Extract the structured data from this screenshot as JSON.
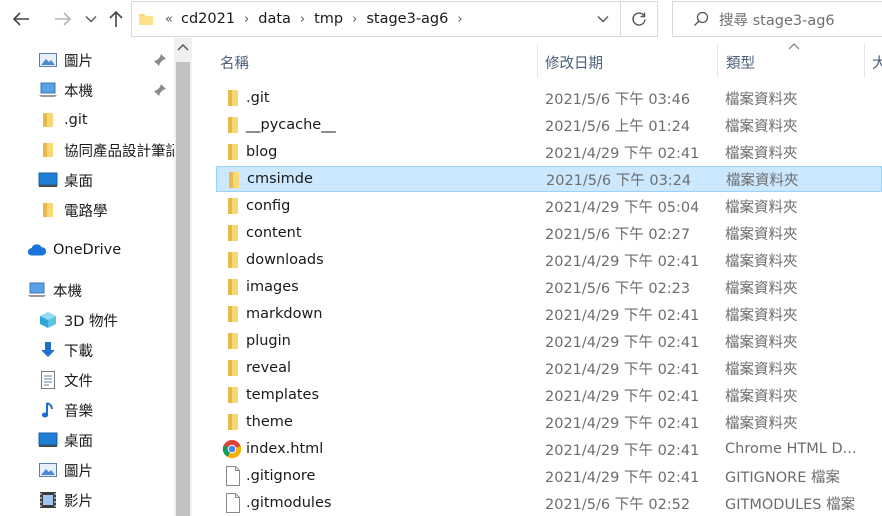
{
  "toolbar": {
    "back_icon": "back-arrow-icon",
    "forward_icon": "forward-arrow-icon",
    "recent_icon": "chevron-down-icon",
    "up_icon": "up-arrow-icon",
    "refresh_icon": "refresh-icon"
  },
  "address": {
    "overflow": "«",
    "crumbs": [
      "cd2021",
      "data",
      "tmp",
      "stage3-ag6"
    ],
    "separator": "›"
  },
  "search": {
    "placeholder": "搜尋 stage3-ag6"
  },
  "nav": {
    "items": [
      {
        "label": "圖片",
        "icon": "pictures-icon",
        "pinned": true
      },
      {
        "label": "本機",
        "icon": "this-pc-icon",
        "pinned": true
      },
      {
        "label": ".git",
        "icon": "folder-icon",
        "pinned": false
      },
      {
        "label": "協同產品設計筆記",
        "icon": "folder-icon",
        "pinned": false
      },
      {
        "label": "桌面",
        "icon": "desktop-icon",
        "pinned": false
      },
      {
        "label": "電路學",
        "icon": "folder-icon",
        "pinned": false
      },
      {
        "label": "OneDrive",
        "icon": "onedrive-icon",
        "pinned": false
      },
      {
        "label": "本機",
        "icon": "this-pc-icon",
        "pinned": false
      },
      {
        "label": "3D 物件",
        "icon": "3d-objects-icon",
        "pinned": false
      },
      {
        "label": "下載",
        "icon": "downloads-icon",
        "pinned": false
      },
      {
        "label": "文件",
        "icon": "documents-icon",
        "pinned": false
      },
      {
        "label": "音樂",
        "icon": "music-icon",
        "pinned": false
      },
      {
        "label": "桌面",
        "icon": "desktop-icon",
        "pinned": false
      },
      {
        "label": "圖片",
        "icon": "pictures-icon",
        "pinned": false
      },
      {
        "label": "影片",
        "icon": "videos-icon",
        "pinned": false
      }
    ]
  },
  "columns": {
    "name": "名稱",
    "date": "修改日期",
    "type": "類型",
    "size": "大"
  },
  "files": [
    {
      "name": ".git",
      "date": "2021/5/6 下午 03:46",
      "type": "檔案資料夾",
      "icon": "folder-icon",
      "selected": false
    },
    {
      "name": "__pycache__",
      "date": "2021/5/6 上午 01:24",
      "type": "檔案資料夾",
      "icon": "folder-icon",
      "selected": false
    },
    {
      "name": "blog",
      "date": "2021/4/29 下午 02:41",
      "type": "檔案資料夾",
      "icon": "folder-icon",
      "selected": false
    },
    {
      "name": "cmsimde",
      "date": "2021/5/6 下午 03:24",
      "type": "檔案資料夾",
      "icon": "folder-icon",
      "selected": true
    },
    {
      "name": "config",
      "date": "2021/4/29 下午 05:04",
      "type": "檔案資料夾",
      "icon": "folder-icon",
      "selected": false
    },
    {
      "name": "content",
      "date": "2021/5/6 下午 02:27",
      "type": "檔案資料夾",
      "icon": "folder-icon",
      "selected": false
    },
    {
      "name": "downloads",
      "date": "2021/4/29 下午 02:41",
      "type": "檔案資料夾",
      "icon": "folder-icon",
      "selected": false
    },
    {
      "name": "images",
      "date": "2021/5/6 下午 02:23",
      "type": "檔案資料夾",
      "icon": "folder-icon",
      "selected": false
    },
    {
      "name": "markdown",
      "date": "2021/4/29 下午 02:41",
      "type": "檔案資料夾",
      "icon": "folder-icon",
      "selected": false
    },
    {
      "name": "plugin",
      "date": "2021/4/29 下午 02:41",
      "type": "檔案資料夾",
      "icon": "folder-icon",
      "selected": false
    },
    {
      "name": "reveal",
      "date": "2021/4/29 下午 02:41",
      "type": "檔案資料夾",
      "icon": "folder-icon",
      "selected": false
    },
    {
      "name": "templates",
      "date": "2021/4/29 下午 02:41",
      "type": "檔案資料夾",
      "icon": "folder-icon",
      "selected": false
    },
    {
      "name": "theme",
      "date": "2021/4/29 下午 02:41",
      "type": "檔案資料夾",
      "icon": "folder-icon",
      "selected": false
    },
    {
      "name": "index.html",
      "date": "2021/4/29 下午 02:41",
      "type": "Chrome HTML D...",
      "icon": "chrome-html-icon",
      "selected": false
    },
    {
      "name": ".gitignore",
      "date": "2021/4/29 下午 02:41",
      "type": "GITIGNORE 檔案",
      "icon": "file-icon",
      "selected": false
    },
    {
      "name": ".gitmodules",
      "date": "2021/5/6 下午 02:52",
      "type": "GITMODULES 檔案",
      "icon": "file-icon",
      "selected": false
    }
  ],
  "colors": {
    "selection_bg": "#cce8ff",
    "selection_border": "#99d1ff",
    "folder": "#f8d775",
    "header_text": "#4c607a"
  }
}
